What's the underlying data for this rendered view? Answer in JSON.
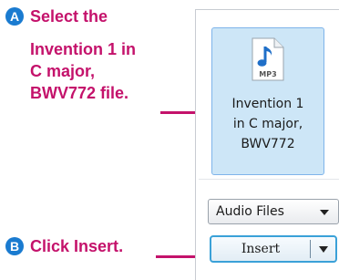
{
  "colors": {
    "accent": "#c4126b",
    "badge_a": "#1a7bd0",
    "badge_b": "#1a7bd0",
    "tile_bg": "#cde6f7",
    "tile_border": "#7eb4ea",
    "focus_border": "#3aa1d8"
  },
  "callouts": {
    "a": {
      "badge": "A",
      "line1": "Select the",
      "line2": "Invention 1 in",
      "line3": "C major,",
      "line4_bold": "BWV772",
      "line4_rest": " file."
    },
    "b": {
      "badge": "B",
      "prefix": "Click ",
      "target": "Insert",
      "suffix": "."
    }
  },
  "file": {
    "icon": "mp3-music-file-icon",
    "icon_label": "MP3",
    "name_lines": [
      "Invention 1",
      "in C major,",
      "BWV772"
    ]
  },
  "filter": {
    "selected": "Audio Files"
  },
  "insert_button": {
    "label": "Insert"
  }
}
